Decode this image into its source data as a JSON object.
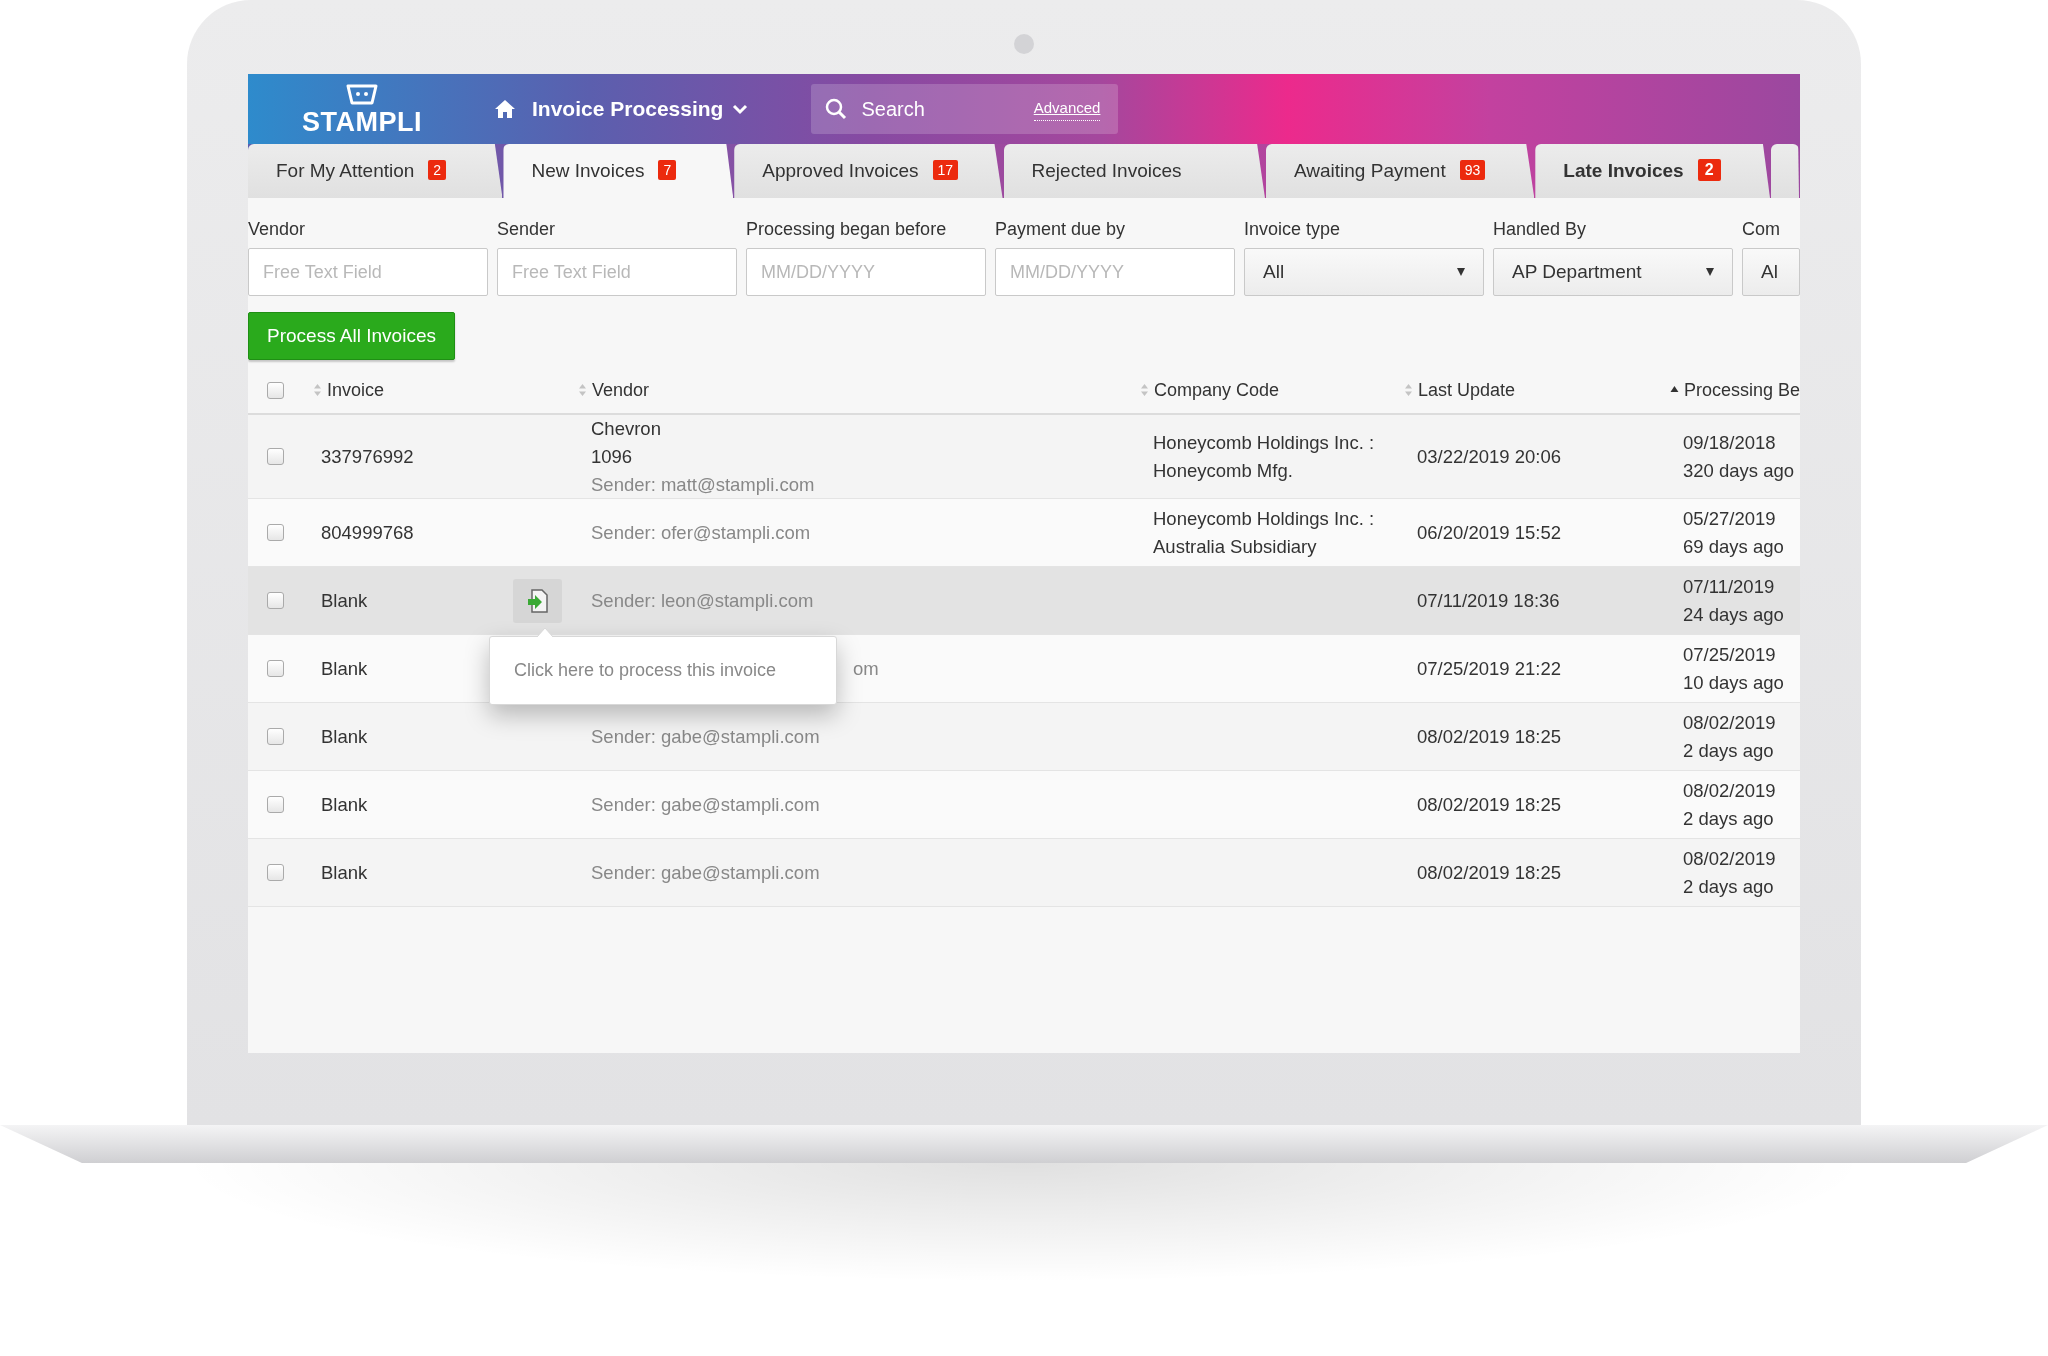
{
  "header": {
    "logo": "STAMPLI",
    "section": "Invoice Processing",
    "search": {
      "placeholder": "Search",
      "advanced": "Advanced"
    }
  },
  "tabs": [
    {
      "label": "For My Attention",
      "count": "2",
      "selected": false,
      "bold": false
    },
    {
      "label": "New Invoices",
      "count": "7",
      "selected": true,
      "bold": false
    },
    {
      "label": "Approved Invoices",
      "count": "17",
      "selected": false,
      "bold": false
    },
    {
      "label": "Rejected Invoices",
      "selected": false,
      "bold": false
    },
    {
      "label": "Awaiting Payment",
      "count": "93",
      "selected": false,
      "bold": false
    },
    {
      "label": "Late Invoices",
      "count": "2",
      "selected": false,
      "bold": true
    }
  ],
  "filters": [
    {
      "label": "Vendor",
      "kind": "text",
      "placeholder": "Free Text Field"
    },
    {
      "label": "Sender",
      "kind": "text",
      "placeholder": "Free Text Field"
    },
    {
      "label": "Processing began before",
      "kind": "text",
      "placeholder": "MM/DD/YYYY"
    },
    {
      "label": "Payment due by",
      "kind": "text",
      "placeholder": "MM/DD/YYYY"
    },
    {
      "label": "Invoice type",
      "kind": "select",
      "value": "All"
    },
    {
      "label": "Handled By",
      "kind": "select",
      "value": "AP Department"
    },
    {
      "label": "Com",
      "kind": "select",
      "value": "Al"
    }
  ],
  "process_button": "Process All Invoices",
  "table": {
    "select_all_checked": false,
    "columns": [
      {
        "label": "Invoice",
        "sorted": false
      },
      {
        "label": "Vendor",
        "sorted": false
      },
      {
        "label": "Company Code",
        "sorted": false
      },
      {
        "label": "Last Update",
        "sorted": false
      },
      {
        "label": "Processing Be",
        "sorted": true
      }
    ],
    "rows": [
      {
        "checked": false,
        "highlighted": false,
        "invoice": "337976992",
        "vendor_name": "Chevron",
        "vendor_code": "1096",
        "sender": "Sender: matt@stampli.com",
        "company": "Honeycomb Holdings Inc. : Honeycomb Mfg.",
        "last_update": "03/22/2019 20:06",
        "processing_date": "09/18/2018",
        "processing_age": "320 days ago"
      },
      {
        "checked": false,
        "highlighted": false,
        "invoice": "804999768",
        "sender": "Sender: ofer@stampli.com",
        "company": "Honeycomb Holdings Inc. : Australia Subsidiary",
        "last_update": "06/20/2019 15:52",
        "processing_date": "05/27/2019",
        "processing_age": "69 days ago"
      },
      {
        "checked": false,
        "highlighted": true,
        "invoice": "Blank",
        "sender": "Sender: leon@stampli.com",
        "action_button": true,
        "tooltip": "Click here to process this invoice",
        "last_update": "07/11/2019 18:36",
        "processing_date": "07/11/2019",
        "processing_age": "24 days ago"
      },
      {
        "checked": false,
        "highlighted": false,
        "invoice": "Blank",
        "sender_tail": "om",
        "last_update": "07/25/2019 21:22",
        "processing_date": "07/25/2019",
        "processing_age": "10 days ago"
      },
      {
        "checked": false,
        "highlighted": false,
        "invoice": "Blank",
        "sender": "Sender: gabe@stampli.com",
        "last_update": "08/02/2019 18:25",
        "processing_date": "08/02/2019",
        "processing_age": "2 days ago"
      },
      {
        "checked": false,
        "highlighted": false,
        "invoice": "Blank",
        "sender": "Sender: gabe@stampli.com",
        "last_update": "08/02/2019 18:25",
        "processing_date": "08/02/2019",
        "processing_age": "2 days ago"
      },
      {
        "checked": false,
        "highlighted": false,
        "invoice": "Blank",
        "sender": "Sender: gabe@stampli.com",
        "last_update": "08/02/2019 18:25",
        "processing_date": "08/02/2019",
        "processing_age": "2 days ago"
      }
    ]
  }
}
